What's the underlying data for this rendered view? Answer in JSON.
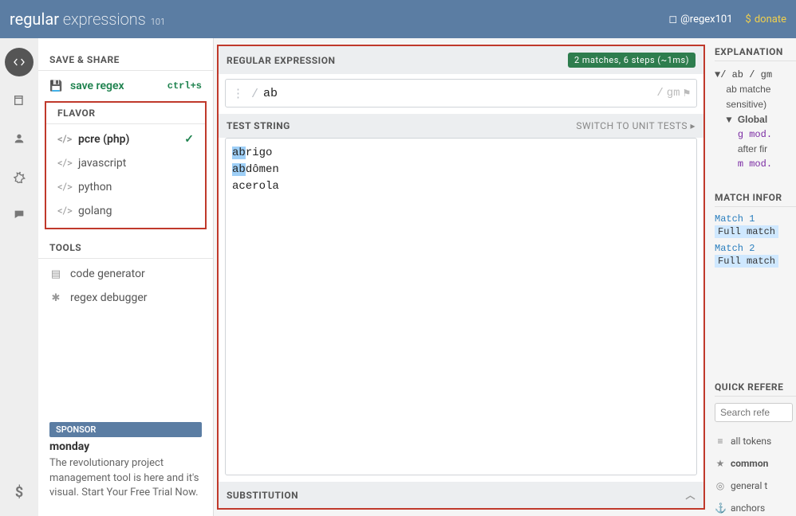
{
  "header": {
    "logo_bold": "regular",
    "logo_light": "expressions",
    "logo_sub": "101",
    "twitter": "@regex101",
    "donate": "donate"
  },
  "sidebar": {
    "save_share": "SAVE & SHARE",
    "save_regex": "save regex",
    "save_shortcut": "ctrl+s",
    "flavor": "FLAVOR",
    "flavors": [
      {
        "label": "pcre (php)",
        "selected": true
      },
      {
        "label": "javascript",
        "selected": false
      },
      {
        "label": "python",
        "selected": false
      },
      {
        "label": "golang",
        "selected": false
      }
    ],
    "tools": "TOOLS",
    "tool_items": [
      {
        "label": "code generator"
      },
      {
        "label": "regex debugger"
      }
    ],
    "sponsor_badge": "SPONSOR",
    "sponsor_title": "monday",
    "sponsor_text": "The revolutionary project management tool is here and it's visual. Start Your Free Trial Now."
  },
  "center": {
    "regex_title": "REGULAR EXPRESSION",
    "match_badge": "2 matches, 6 steps (~1ms)",
    "regex_value": "ab",
    "flags": "gm",
    "test_title": "TEST STRING",
    "switch_unit": "SWITCH TO UNIT TESTS ▸",
    "test_lines": [
      {
        "match": "ab",
        "rest": "rigo"
      },
      {
        "match": "ab",
        "rest": "dômen"
      },
      {
        "match": "",
        "rest": "acerola"
      }
    ],
    "substitution": "SUBSTITUTION"
  },
  "right": {
    "explanation": "EXPLANATION",
    "expl_line1a": "/ ",
    "expl_line1b": "ab",
    "expl_line1c": " / gm",
    "expl_line2": "ab matche",
    "expl_line3": "sensitive)",
    "expl_global": "Global",
    "expl_g": "g mod.",
    "expl_after": "after fir",
    "expl_m": "m mod.",
    "match_info": "MATCH INFOR",
    "match1": "Match 1",
    "full_match": "Full match",
    "match2": "Match 2",
    "quick_ref": "QUICK REFERE",
    "qr_search": "Search refe",
    "qr_items": [
      {
        "icon": "≡",
        "label": "all tokens"
      },
      {
        "icon": "★",
        "label": "common"
      },
      {
        "icon": "◎",
        "label": "general t"
      },
      {
        "icon": "⚓",
        "label": "anchors"
      }
    ]
  }
}
